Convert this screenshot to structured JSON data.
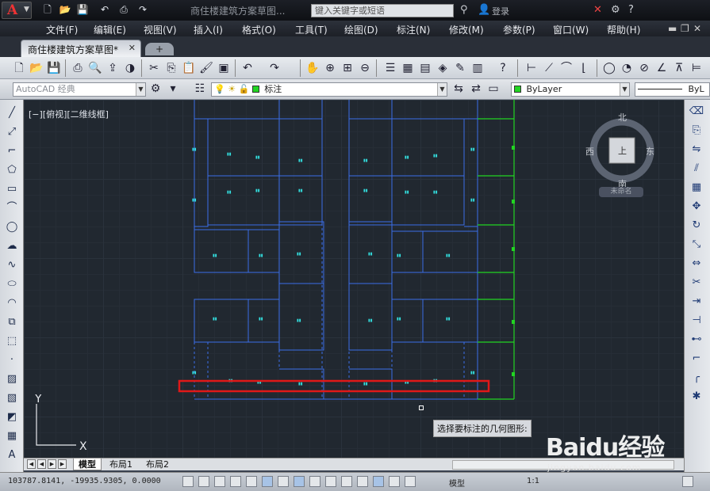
{
  "title_bar": {
    "title": "商住楼建筑方案草图...",
    "search_placeholder": "键入关键字或短语",
    "user_label": "登录",
    "help": "?"
  },
  "menu": [
    "文件(F)",
    "编辑(E)",
    "视图(V)",
    "插入(I)",
    "格式(O)",
    "工具(T)",
    "绘图(D)",
    "标注(N)",
    "修改(M)",
    "参数(P)",
    "窗口(W)",
    "帮助(H)"
  ],
  "document_tab": {
    "label": "商住楼建筑方案草图*"
  },
  "toolbar2": {
    "workspace": "AutoCAD 经典",
    "layer_name": "标注",
    "color": "ByLayer",
    "linetype": "ByL"
  },
  "viewport_label": "[−][俯视][二维线框]",
  "viewcube": {
    "north": "北",
    "south": "南",
    "east": "东",
    "west": "西",
    "ucs_name": "未命名",
    "face": "上"
  },
  "ucs": {
    "y": "Y",
    "x": "X"
  },
  "command_tooltip": "选择要标注的几何图形:",
  "layout_tabs": [
    "模型",
    "布局1",
    "布局2"
  ],
  "status": {
    "coordinates": "103787.8141, -19935.9305, 0.0000",
    "model_label": "模型",
    "scale": "1:1"
  },
  "watermark": {
    "text": "Baidu经验",
    "sub": "jingyan.baidu.com"
  },
  "colors": {
    "canvas_bg": "#212830",
    "plan_lines": "#3a6ee8",
    "plan_text": "#33e0e0",
    "green_lines": "#22d422",
    "selection_box": "#e01818"
  }
}
